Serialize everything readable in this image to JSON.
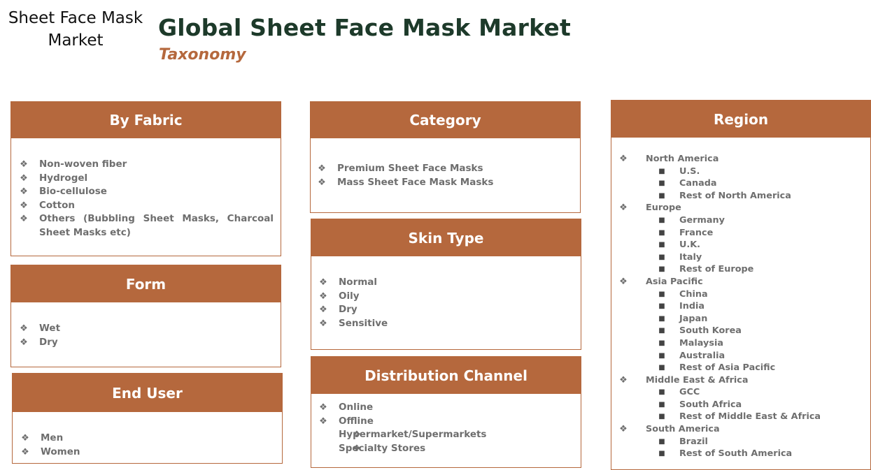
{
  "header": {
    "logo_text": "Sheet Face Mask Market",
    "title": "Global Sheet Face Mask Market",
    "subtitle": "Taxonomy"
  },
  "colors": {
    "accent": "#b5683d",
    "title": "#1d3a2a",
    "item_text": "#6e6e6e"
  },
  "panels": {
    "fabric": {
      "title": "By Fabric",
      "items": [
        "Non-woven fiber",
        "Hydrogel",
        "Bio-cellulose",
        "Cotton",
        "Others (Bubbling Sheet Masks, Charcoal Sheet Masks etc)"
      ]
    },
    "form": {
      "title": "Form",
      "items": [
        "Wet",
        "Dry"
      ]
    },
    "end_user": {
      "title": "End User",
      "items": [
        "Men",
        "Women"
      ]
    },
    "category": {
      "title": "Category",
      "items": [
        "Premium Sheet Face Masks",
        "Mass Sheet Face Mask Masks"
      ]
    },
    "skin_type": {
      "title": "Skin Type",
      "items": [
        "Normal",
        "Oily",
        "Dry",
        "Sensitive"
      ]
    },
    "distribution": {
      "title": "Distribution Channel",
      "items": [
        "Online",
        "Offline"
      ],
      "offline_items": [
        "Hypermarket/Supermarkets",
        "Specialty Stores"
      ]
    },
    "region": {
      "title": "Region",
      "groups": [
        {
          "name": "North America",
          "items": [
            "U.S.",
            "Canada",
            "Rest of North America"
          ]
        },
        {
          "name": "Europe",
          "items": [
            "Germany",
            "France",
            "U.K.",
            "Italy",
            "Rest of Europe"
          ]
        },
        {
          "name": "Asia Pacific",
          "items": [
            "China",
            "India",
            "Japan",
            "South Korea",
            "Malaysia",
            "Australia",
            "Rest of Asia Pacific"
          ]
        },
        {
          "name": "Middle East & Africa",
          "items": [
            "GCC",
            "South Africa",
            "Rest of Middle East & Africa"
          ]
        },
        {
          "name": "South America",
          "items": [
            "Brazil",
            "Rest of South America"
          ]
        }
      ]
    }
  }
}
